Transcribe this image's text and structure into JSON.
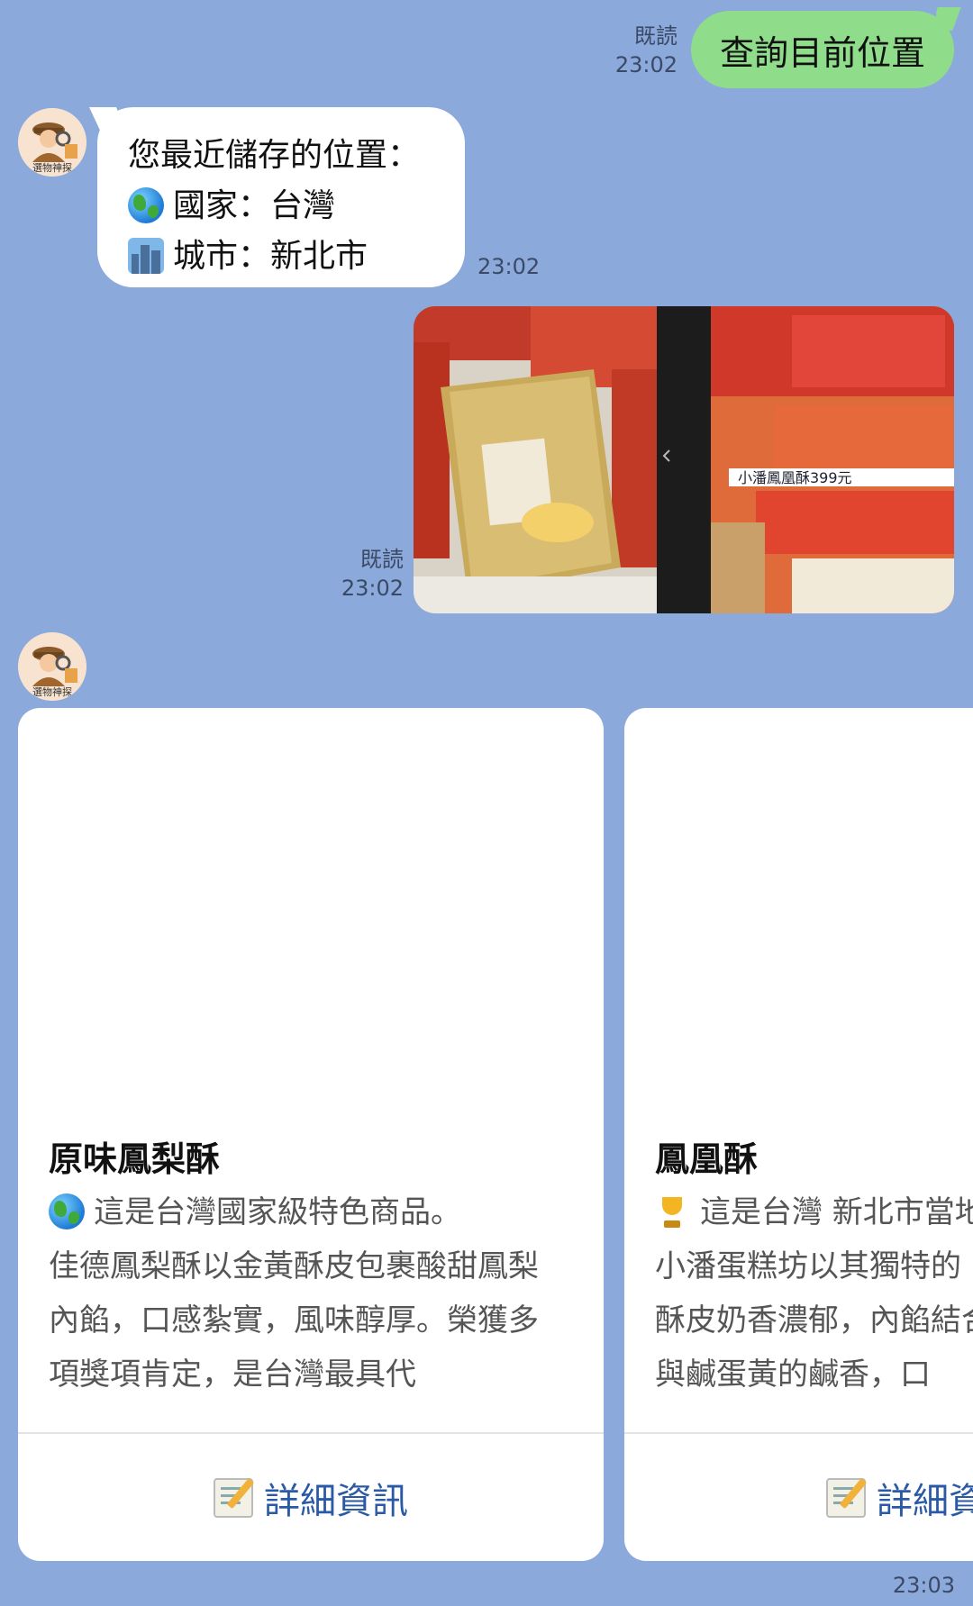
{
  "messages": {
    "outgoing_text": {
      "text": "查詢目前位置",
      "read_label": "既読",
      "time": "23:02"
    },
    "location_reply": {
      "line1": "您最近儲存的位置：",
      "country_label": "國家：台灣",
      "city_label": "城市：新北市",
      "time": "23:02",
      "icons": [
        "globe-icon",
        "cityscape-icon"
      ]
    },
    "outgoing_image": {
      "read_label": "既読",
      "time": "23:02",
      "sign_text": "小潘鳳凰酥399元"
    },
    "avatar": {
      "label": "選物神探"
    }
  },
  "cards": [
    {
      "title": "原味鳳梨酥",
      "desc_lines": [
        "這是台灣國家級特色商品。",
        "佳德鳳梨酥以金黃酥皮包裹酸甜鳳梨",
        "內餡，口感紮實，風味醇厚。榮獲多",
        "項獎項肯定，是台灣最具代"
      ],
      "desc_icon": "globe-icon",
      "button_label": "詳細資訊",
      "button_icon": "memo-icon"
    },
    {
      "title": "鳳凰酥",
      "desc_lines": [
        "這是台灣 新北市當地",
        "小潘蛋糕坊以其獨特的",
        "酥皮奶香濃郁，內餡結合",
        "與鹹蛋黃的鹹香，口"
      ],
      "desc_icon": "trophy-icon",
      "button_label": "詳細資",
      "button_icon": "memo-icon"
    }
  ],
  "cards_time": "23:03"
}
